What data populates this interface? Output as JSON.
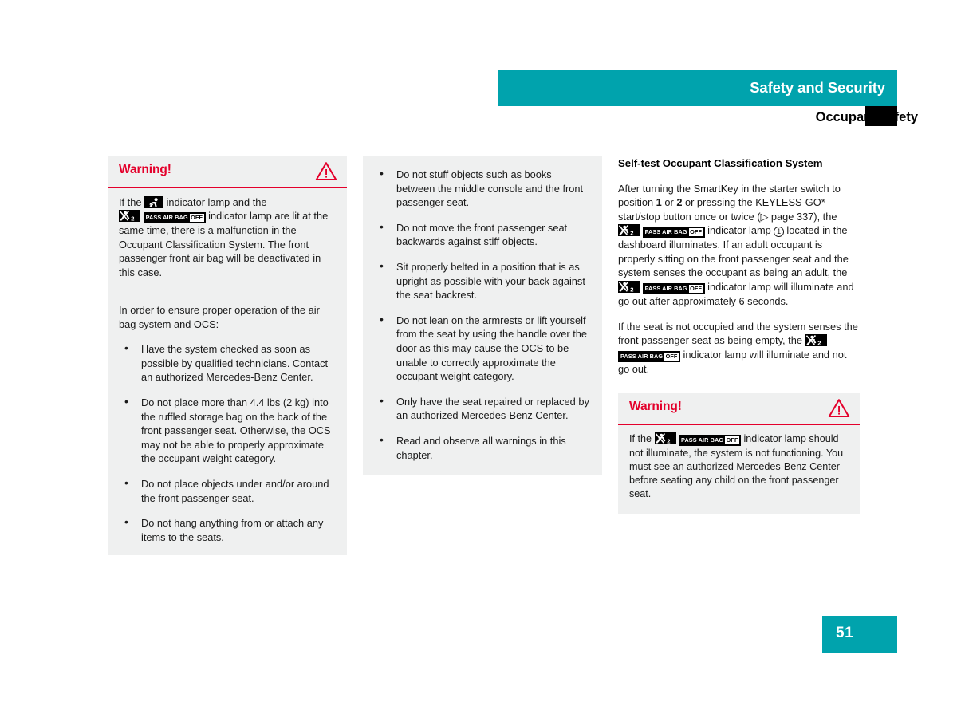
{
  "header": {
    "chapter_title": "Safety and Security",
    "section_title": "Occupant safety"
  },
  "icons": {
    "airbag_lamp_name": "airbag-indicator-lamp-icon",
    "child_seat_name": "child-seat-airbag-off-icon",
    "pass_air_bag_text": "PASS AIR BAG",
    "pass_air_bag_off": "OFF",
    "warning_triangle_name": "warning-triangle-icon"
  },
  "column1": {
    "warning": {
      "title": "Warning!",
      "body_part1": "If the",
      "body_part2": "indicator lamp and the",
      "body_part3": "indicator lamp are lit at the same time, there is a malfunction in the Occupant Classification System. The front passenger front air bag will be deactivated in this case."
    },
    "intro": "In order to ensure proper operation of the air bag system and OCS:",
    "bullets": [
      "Have the system checked as soon as possible by qualified technicians. Contact an authorized Mercedes-Benz Center.",
      "Do not place more than 4.4 lbs (2 kg) into the ruffled storage bag on the back of the front passenger seat. Otherwise, the OCS may not be able to properly approximate the occupant weight category.",
      "Do not place objects under and/or around the front passenger seat.",
      "Do not hang anything from or attach any items to the seats."
    ]
  },
  "column2": {
    "bullets": [
      "Do not stuff objects such as books between the middle console and the front passenger seat.",
      "Do not move the front passenger seat backwards against stiff objects.",
      "Sit properly belted in a position that is as upright as possible with your back against the seat backrest.",
      "Do not lean on the armrests or lift yourself from the seat by using the handle over the door as this may cause the OCS to be unable to correctly approximate the occupant weight category.",
      "Only have the seat repaired or replaced by an authorized Mercedes-Benz Center.",
      "Read and observe all warnings in this chapter."
    ]
  },
  "column3": {
    "heading": "Self-test Occupant Classification System",
    "para1_a": "After turning the SmartKey in the starter switch to position",
    "para1_pos1": "1",
    "para1_b": "or",
    "para1_pos2": "2",
    "para1_c": "or pressing the KEYLESS-GO* start/stop button once or twice (▷ page 337), the",
    "para1_d": "indicator lamp",
    "para1_callout": "1",
    "para1_e": "located in the dashboard illuminates. If an adult occupant is properly sitting on the front passenger seat and the system senses the occupant as being an adult, the",
    "para1_f": "indicator lamp will illuminate and go out after approximately 6 seconds.",
    "para2_a": "If the seat is not occupied and the system senses the front passenger seat as being empty, the",
    "para2_b": "indicator lamp will illuminate and not go out.",
    "warning": {
      "title": "Warning!",
      "body_a": "If the",
      "body_b": "indicator lamp should not illuminate, the system is not functioning. You must see an authorized Mercedes-Benz Center before seating any child on the front passenger seat."
    }
  },
  "page_number": "51",
  "colors": {
    "accent_teal": "#00a3ad",
    "warning_red": "#e4002b",
    "panel_gray": "#eff0f0",
    "text": "#1a1a1a"
  }
}
